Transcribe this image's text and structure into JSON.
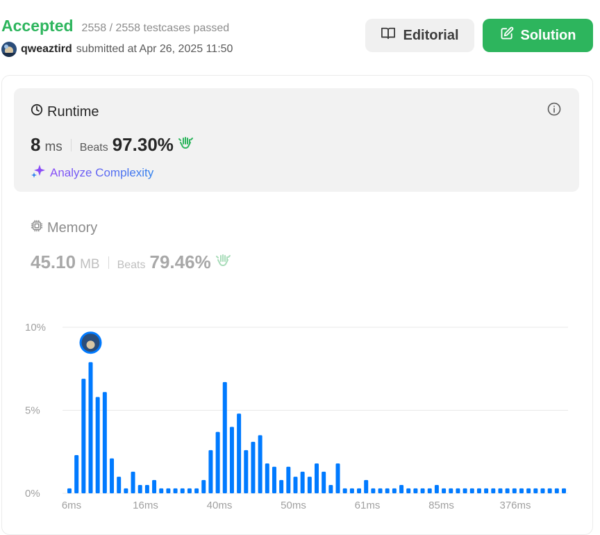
{
  "header": {
    "status": "Accepted",
    "testcases": "2558 / 2558 testcases passed",
    "username": "qweaztird",
    "submitted_text": "submitted at Apr 26, 2025 11:50",
    "editorial_label": "Editorial",
    "solution_label": "Solution"
  },
  "runtime": {
    "title": "Runtime",
    "value": "8",
    "unit": "ms",
    "beats_label": "Beats",
    "beats_pct": "97.30%",
    "analyze_label": "Analyze Complexity"
  },
  "memory": {
    "title": "Memory",
    "value": "45.10",
    "unit": "MB",
    "beats_label": "Beats",
    "beats_pct": "79.46%"
  },
  "colors": {
    "accepted": "#2db55d",
    "bar": "#007aff",
    "solution_button": "#2db55d"
  },
  "chart_data": {
    "type": "bar",
    "title": "",
    "xlabel": "",
    "ylabel": "",
    "ylim": [
      0,
      10
    ],
    "y_ticks": [
      "0%",
      "5%",
      "10%"
    ],
    "x_tick_labels": [
      "6ms",
      "16ms",
      "40ms",
      "50ms",
      "61ms",
      "85ms",
      "376ms"
    ],
    "grid": true,
    "highlighted_index": 3,
    "values": [
      0.3,
      2.3,
      6.9,
      7.9,
      5.8,
      6.1,
      2.1,
      1.0,
      0.3,
      1.3,
      0.5,
      0.5,
      0.8,
      0.3,
      0.3,
      0.3,
      0.3,
      0.3,
      0.3,
      0.8,
      2.6,
      3.7,
      6.7,
      4.0,
      4.8,
      2.6,
      3.1,
      3.5,
      1.8,
      1.6,
      0.8,
      1.6,
      1.0,
      1.3,
      1.0,
      1.8,
      1.3,
      0.5,
      1.8,
      0.3,
      0.3,
      0.3,
      0.8,
      0.3,
      0.3,
      0.3,
      0.3,
      0.5,
      0.3,
      0.3,
      0.3,
      0.3,
      0.5,
      0.3,
      0.3,
      0.3,
      0.3,
      0.3,
      0.3,
      0.3,
      0.3,
      0.3,
      0.3,
      0.3,
      0.3,
      0.3,
      0.3,
      0.3,
      0.3,
      0.3,
      0.3
    ]
  }
}
